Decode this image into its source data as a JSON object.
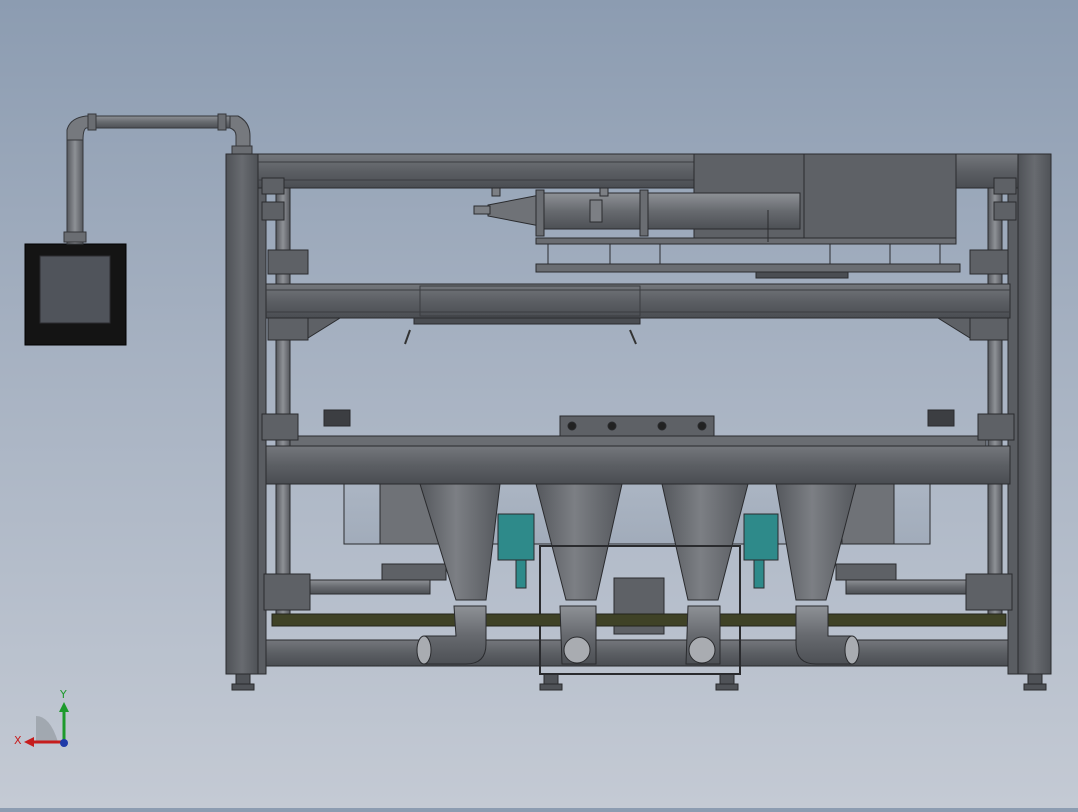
{
  "app": {
    "window_title": "",
    "view": "Front"
  },
  "model": {
    "name": "",
    "assembly_type": "hopper-packaging-machine-frame",
    "hoppers_count": 4,
    "elbows_count": 4
  },
  "triad": {
    "x_label": "X",
    "y_label": "Y"
  },
  "colors": {
    "background_top": "#8c9cb1",
    "background_bottom": "#c4cad4",
    "frame": "#5e6166",
    "frame_edge": "#2a2b2e",
    "hopper": "#6d7075",
    "accent_teal": "#2e8a8a",
    "rail_olive": "#3f4226",
    "panel": "#1b1b1c",
    "panel_screen": "#50545b",
    "x_axis": "#c61d1d",
    "y_axis": "#1d9a2c",
    "z_axis": "#1f3aa8"
  },
  "icons": {
    "triad": "xyz-axis-triad-icon",
    "control_panel": "control-box-icon"
  }
}
